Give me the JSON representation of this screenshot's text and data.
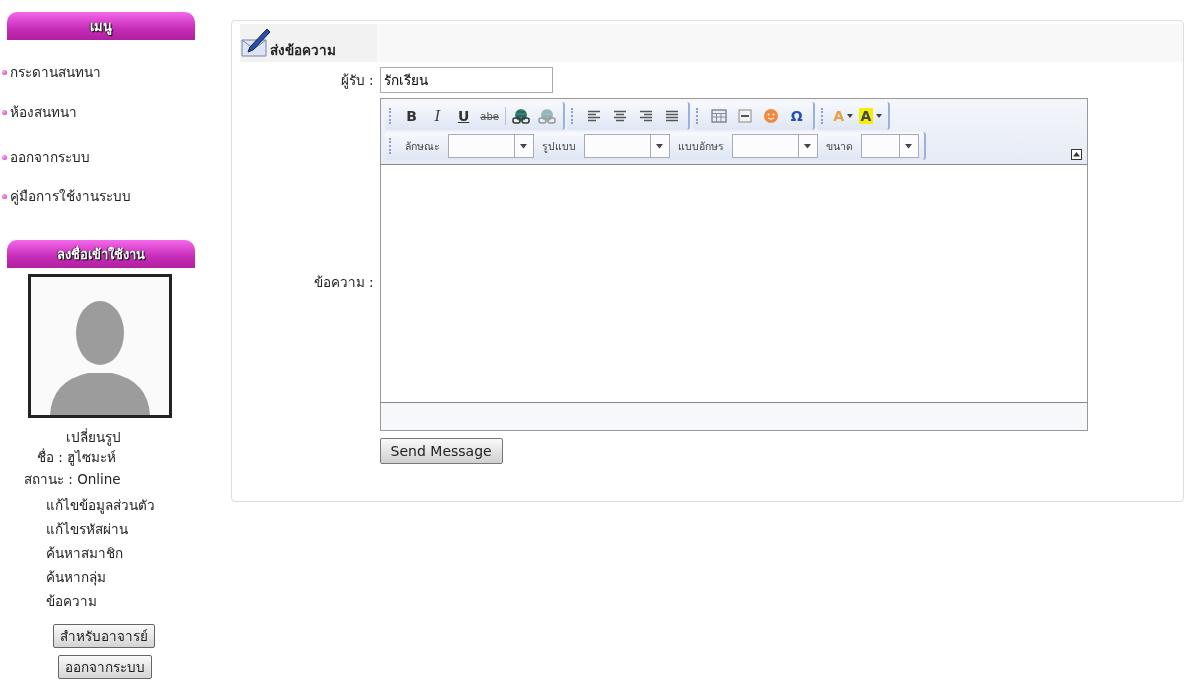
{
  "sidebar": {
    "menu_title": "เมนู",
    "menu_items": [
      "กระดานสนทนา",
      "ห้องสนทนา",
      "ออกจากระบบ",
      "คู่มือการใช้งานระบบ"
    ],
    "login_title": "ลงชื่อเข้าใช้งาน",
    "change_photo": "เปลี่ยนรูป",
    "name_line": "ชื่อ : ฮูไซมะห์",
    "status_line": "สถานะ : Online",
    "links": [
      "แก้ไขข้อมูลส่วนตัว",
      "แก้ไขรหัสผ่าน",
      "ค้นหาสมาชิก",
      "ค้นหากลุ่ม",
      "ข้อความ"
    ],
    "buttons": [
      "สำหรับอาจารย์",
      "ออกจากระบบ"
    ]
  },
  "compose": {
    "title": "ส่งข้อความ",
    "recipient_label": "ผู้รับ :",
    "recipient_value": "รักเรียน",
    "message_label": "ข้อความ :",
    "toolbar": {
      "format_buttons": [
        {
          "kind": "bold",
          "label": "B"
        },
        {
          "kind": "italic",
          "label": "I"
        },
        {
          "kind": "underline",
          "label": "U"
        },
        {
          "kind": "strike",
          "label": "abe"
        }
      ],
      "symbol_button": "Ω",
      "color_buttons": [
        "A",
        "A"
      ],
      "dropdowns": [
        "ลักษณะ",
        "รูปแบบ",
        "แบบอักษร",
        "ขนาด"
      ]
    },
    "send_button": "Send Message"
  }
}
